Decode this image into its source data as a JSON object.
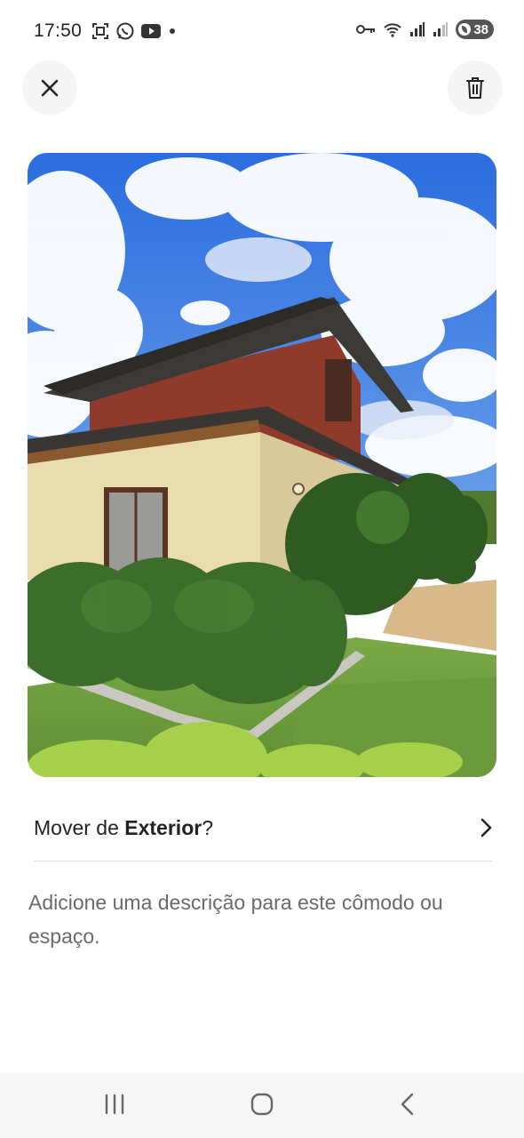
{
  "status_bar": {
    "time": "17:50",
    "battery": "38",
    "icons": [
      "screenshot-icon",
      "whatsapp-icon",
      "youtube-icon",
      "notification-dot-icon",
      "key-icon",
      "wifi-icon",
      "signal-icon",
      "signal-weak-icon",
      "battery-icon"
    ]
  },
  "toolbar": {
    "close_icon": "close-icon",
    "delete_icon": "trash-icon"
  },
  "photo": {
    "subject": "house-exterior-photo"
  },
  "move_row": {
    "prefix": "Mover de ",
    "room": "Exterior",
    "suffix": "?",
    "chevron_icon": "chevron-right-icon"
  },
  "description": {
    "placeholder": "Adicione uma descrição para este cômodo ou espaço."
  },
  "nav_bar": {
    "icons": [
      "recent-apps-icon",
      "home-icon",
      "back-icon"
    ]
  },
  "colors": {
    "text_primary": "#222222",
    "text_secondary": "#6a6a6a",
    "button_bg": "#f5f5f5",
    "divider": "#e2e2e2"
  }
}
